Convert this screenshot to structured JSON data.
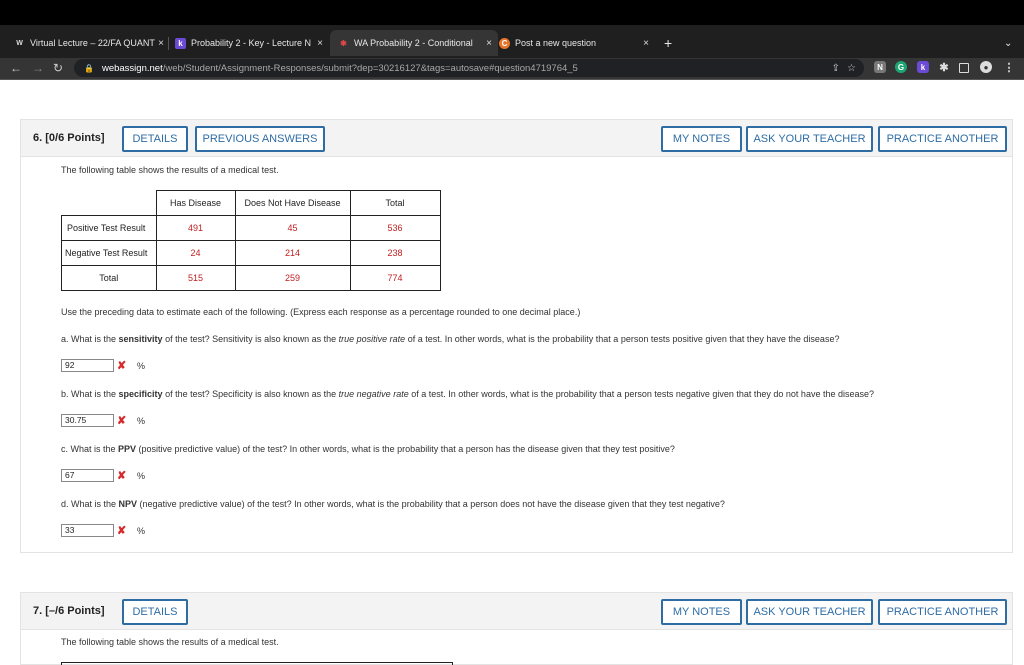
{
  "browser": {
    "tabs": [
      {
        "label": "Virtual Lecture – 22/FA QUANT",
        "close": "×"
      },
      {
        "label": "Probability 2 - Key - Lecture N",
        "close": "×"
      },
      {
        "label": "WA Probability 2 - Conditional",
        "close": "×"
      },
      {
        "label": "Post a new question",
        "close": "×"
      }
    ],
    "new_tab": "+",
    "url_host": "webassign.net",
    "url_path": "/web/Student/Assignment-Responses/submit?dep=30216127&tags=autosave#question4719764_5"
  },
  "q6": {
    "title": "6.  [0/6 Points]",
    "details": "DETAILS",
    "previous": "PREVIOUS ANSWERS",
    "notes": "MY NOTES",
    "ask": "ASK YOUR TEACHER",
    "practice": "PRACTICE ANOTHER",
    "intro": "The following table shows the results of a medical test.",
    "table": {
      "headers": [
        "",
        "Has Disease",
        "Does Not Have Disease",
        "Total"
      ],
      "rows": [
        [
          "Positive Test Result",
          "491",
          "45",
          "536"
        ],
        [
          "Negative Test Result",
          "24",
          "214",
          "238"
        ],
        [
          "Total",
          "515",
          "259",
          "774"
        ]
      ]
    },
    "instructions": "Use the preceding data to estimate each of the following. (Express each response as a percentage rounded to one decimal place.)",
    "a": {
      "pre": "a. What is the ",
      "bold": "sensitivity",
      "mid": " of the test? Sensitivity is also known as the ",
      "ital": "true positive rate",
      "post": " of a test. In other words, what is the probability that a person tests positive given that they have the disease?",
      "answer": "92"
    },
    "b": {
      "pre": "b. What is the ",
      "bold": "specificity",
      "mid": " of the test? Specificity is also known as the ",
      "ital": "true negative rate",
      "post": " of a test. In other words, what is the probability that a person tests negative given that they do not have the disease?",
      "answer": "30.75"
    },
    "c": {
      "pre": "c. What is the ",
      "bold": "PPV",
      "post": " (positive predictive value) of the test? In other words, what is the probability that a person has the disease given that they test positive?",
      "answer": "67"
    },
    "d": {
      "pre": "d. What is the ",
      "bold": "NPV",
      "post": " (negative predictive value) of the test? In other words, what is the probability that a person does not have the disease given that they test negative?",
      "answer": "33"
    },
    "x_mark": "✘",
    "unit": "%"
  },
  "q7": {
    "title": "7.  [–/6 Points]",
    "details": "DETAILS",
    "notes": "MY NOTES",
    "ask": "ASK YOUR TEACHER",
    "practice": "PRACTICE ANOTHER",
    "intro": "The following table shows the results of a medical test."
  }
}
